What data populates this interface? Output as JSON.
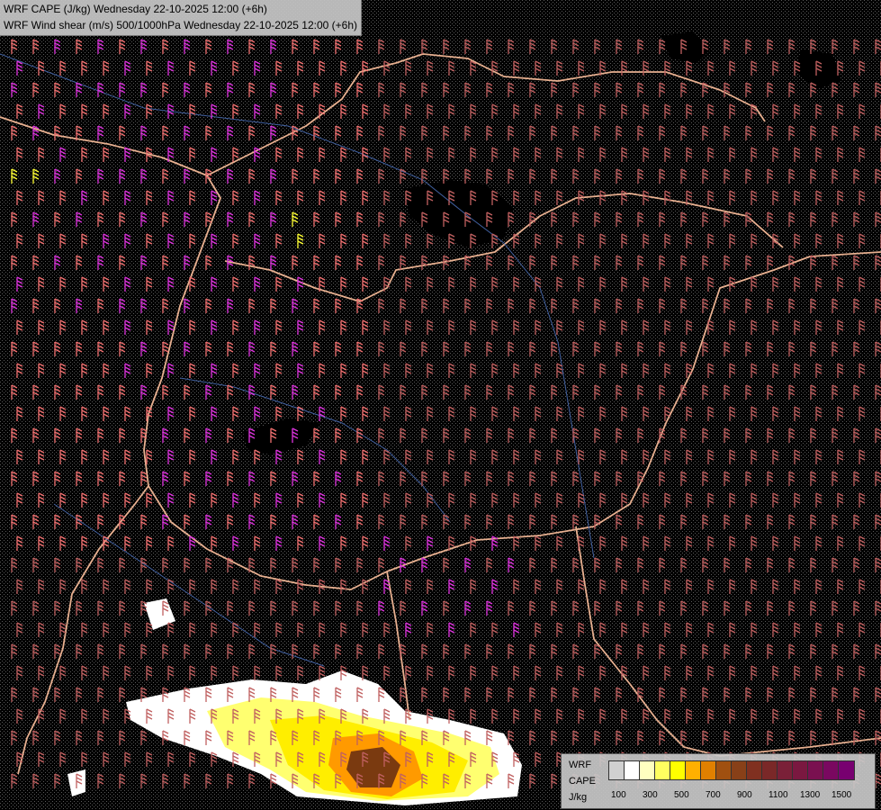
{
  "title": {
    "line1": "WRF CAPE (J/kg) Wednesday 22-10-2025 12:00 (+6h)",
    "line2": "WRF Wind shear (m/s) 500/1000hPa Wednesday 22-10-2025 12:00 (+6h)"
  },
  "legend": {
    "label_top": "WRF",
    "label_mid": "CAPE",
    "label_unit": "J/kg",
    "colors": [
      "#d0d0d0",
      "#ffffff",
      "#ffffc0",
      "#ffff60",
      "#ffff00",
      "#ffb000",
      "#e08000",
      "#a05010",
      "#884018",
      "#803020",
      "#7a2828",
      "#7a2038",
      "#7a1840",
      "#7a1050",
      "#7a0860",
      "#780070"
    ],
    "ticks": [
      "100",
      "300",
      "500",
      "700",
      "900",
      "1100",
      "1300",
      "1500"
    ]
  },
  "map": {
    "background": "#000000",
    "stipple": "#5a5a5a",
    "border_color": "#e8b090",
    "river_color": "#4060a0",
    "barb_colors": {
      "low": "#c06060",
      "mid": "#f07070",
      "high": "#dd33dd",
      "extreme": "#ffff33"
    }
  }
}
